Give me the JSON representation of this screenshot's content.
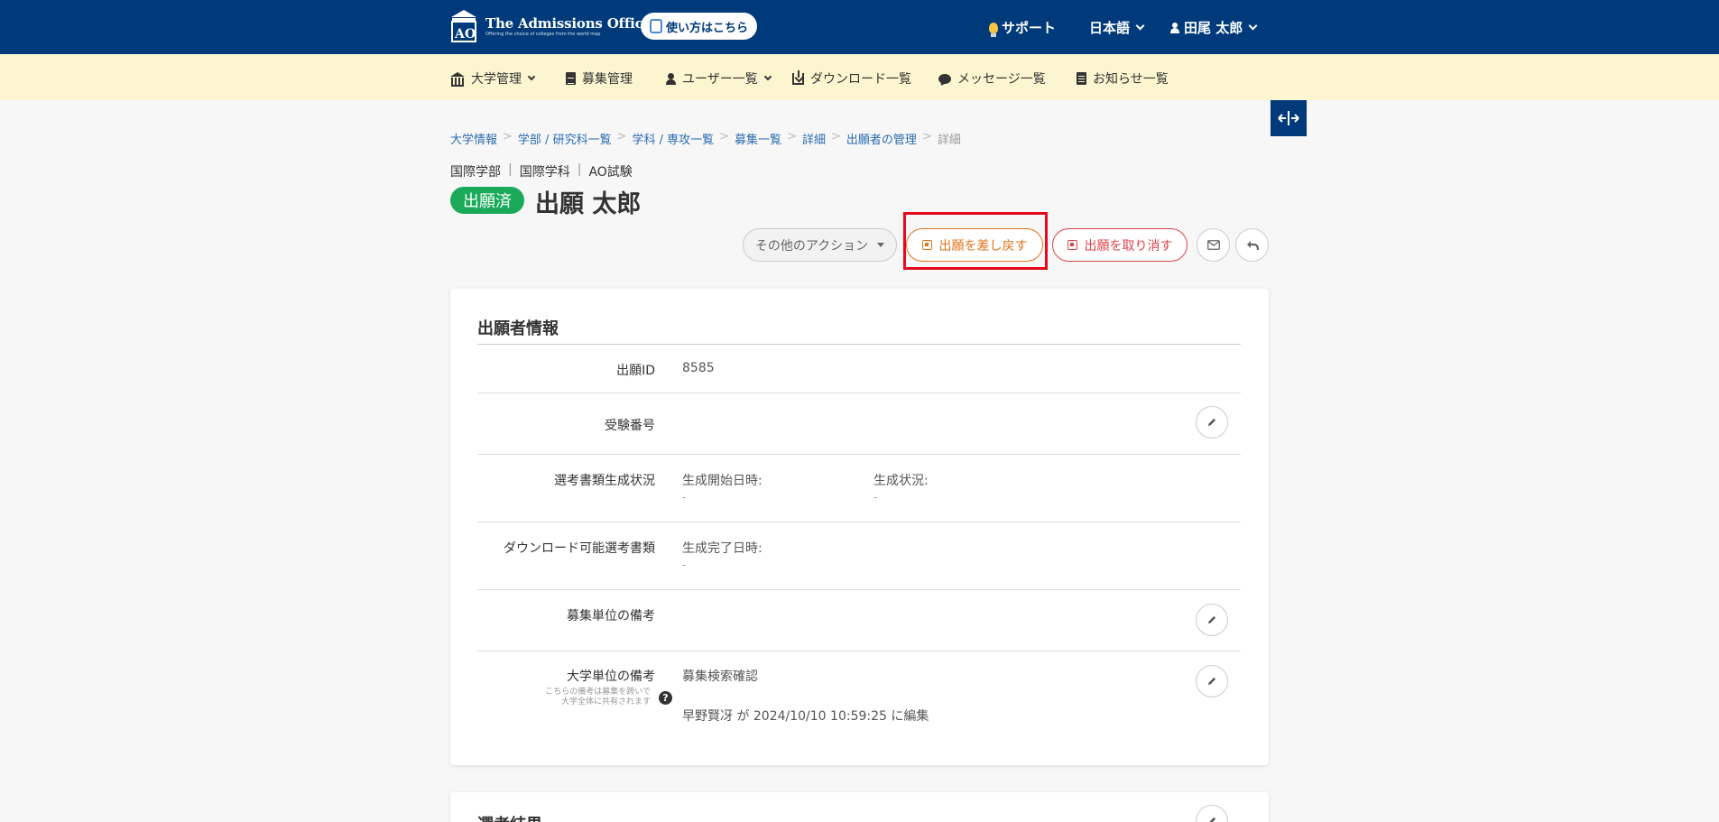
{
  "topbar": {
    "logo_title": "The Admissions Office",
    "logo_subtitle": "Offering the choice of colleges from the world map",
    "howto_label": "使い方はこちら",
    "support_label": "サポート",
    "language_label": "日本語",
    "user_label": "田尾 太郎"
  },
  "subnav": {
    "items": [
      {
        "label": "大学管理",
        "icon": "bank-icon"
      },
      {
        "label": "募集管理",
        "icon": "file-icon"
      },
      {
        "label": "ユーザー一覧",
        "icon": "user-icon"
      },
      {
        "label": "ダウンロード一覧",
        "icon": "download-icon"
      },
      {
        "label": "メッセージ一覧",
        "icon": "comment-icon"
      },
      {
        "label": "お知らせ一覧",
        "icon": "document-icon"
      }
    ]
  },
  "breadcrumb": [
    "大学情報",
    "学部 / 研究科一覧",
    "学科 / 専攻一覧",
    "募集一覧",
    "詳細",
    "出願者の管理",
    "詳細"
  ],
  "header": {
    "faculty": "国際学部",
    "department": "国際学科",
    "exam": "AO試験",
    "status_badge": "出願済",
    "applicant_name": "出願 太郎"
  },
  "actions": {
    "other_actions_label": "その他のアクション",
    "return_label": "出願を差し戻す",
    "cancel_label": "出願を取り消す"
  },
  "applicant_info": {
    "title": "出願者情報",
    "application_id_label": "出願ID",
    "application_id_value": "8585",
    "exam_number_label": "受験番号",
    "doc_generation_label": "選考書類生成状況",
    "gen_start_label": "生成開始日時:",
    "gen_start_value": "-",
    "gen_status_label": "生成状況:",
    "gen_status_value": "-",
    "downloadable_docs_label": "ダウンロード可能選考書類",
    "gen_complete_label": "生成完了日時:",
    "gen_complete_value": "-",
    "recruitment_note_label": "募集単位の備考",
    "university_note_label": "大学単位の備考",
    "university_note_help_line1": "こちらの備考は募集を跨いで",
    "university_note_help_line2": "大学全体に共有されます",
    "university_note_value": "募集検索確認",
    "university_note_edited": "早野賢冴 が 2024/10/10 10:59:25 に編集"
  },
  "selection_results": {
    "title": "選考結果"
  },
  "colors": {
    "navy": "#003a7a",
    "subnav_bg": "#fbf6cf",
    "status_green": "#1aaa5a",
    "return_orange": "#e3741d",
    "cancel_red": "#e0434c",
    "highlight_red": "#e5081f"
  }
}
